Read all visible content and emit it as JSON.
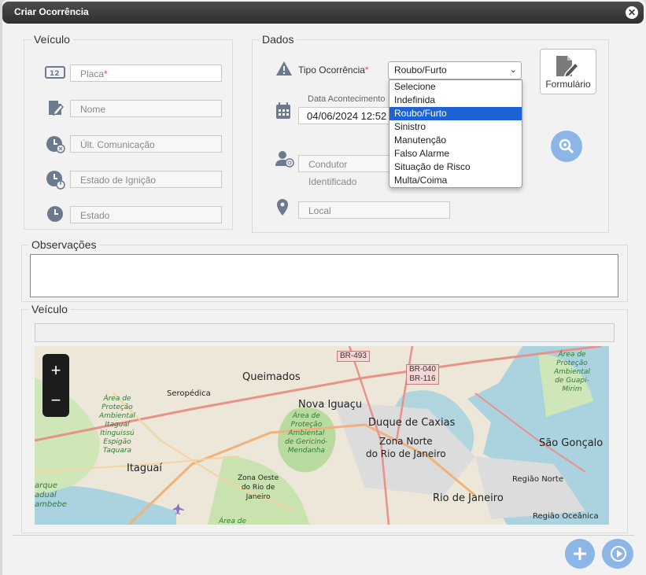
{
  "dialog": {
    "title": "Criar Ocorrência"
  },
  "veiculo": {
    "legend": "Veículo",
    "placa_placeholder": "Placa",
    "placa_required": "*",
    "nome_placeholder": "Nome",
    "ult_comunicacao_placeholder": "Últ. Comunicação",
    "estado_ignicao_placeholder": "Estado de Ignição",
    "estado_placeholder": "Estado"
  },
  "dados": {
    "legend": "Dados",
    "tipo_label": "Tipo Ocorrência",
    "tipo_required": "*",
    "tipo_value": "Roubo/Furto",
    "options": [
      "Selecione",
      "Indefinida",
      "Roubo/Furto",
      "Sinistro",
      "Manutenção",
      "Falso Alarme",
      "Situação de Risco",
      "Multa/Coima"
    ],
    "selected_index": 2,
    "data_label": "Data Acontecimento",
    "data_value": "04/06/2024 12:52",
    "condutor_placeholder": "Condutor Identificado",
    "local_placeholder": "Local",
    "formulario_label": "Formulário"
  },
  "observacoes": {
    "legend": "Observações"
  },
  "veiculo_map": {
    "legend": "Veículo",
    "labels": {
      "queimados": "Queimados",
      "seropedica": "Seropédica",
      "nova_iguacu": "Nova Iguaçu",
      "duque": "Duque de Caxias",
      "zona_norte_1": "Zona Norte",
      "zona_norte_2": "do Rio de Janeiro",
      "sao_goncalo": "São Gonçalo",
      "itaguai": "Itaguaí",
      "zona_oeste": "Zona Oeste\ndo Rio de\nJaneiro",
      "rio": "Rio de Janeiro",
      "regiao_norte": "Região Norte",
      "regiao_oceanica": "Região Oceânica",
      "apa_itaguai": "Área de\nProteção\nAmbiental\nItaguaí\nItinguissú\nEspigão\nTaquara",
      "apa_gericino": "Área de\nProteção\nAmbiental\nde Gericinó-\nMendanha",
      "apa_guapi": "Área de\nProteção\nAmbiental\nde Guapi-\nMirim",
      "area_de": "Área de",
      "marque": "arque\nadual\nambebe",
      "br493": "BR-493",
      "br040": "BR-040\nBR-116"
    }
  },
  "colors": {
    "accent": "#1e63d6",
    "round_button": "#8cb6e8",
    "required": "#d9534f"
  },
  "icons": [
    "plate-icon",
    "edit-document-icon",
    "clock-communication-icon",
    "clock-ignition-icon",
    "clock-icon",
    "warning-icon",
    "calendar-icon",
    "driver-icon",
    "map-pin-icon",
    "document-edit-icon",
    "search-location-icon",
    "add-icon",
    "play-icon",
    "zoom-in-icon",
    "zoom-out-icon",
    "airport-icon"
  ]
}
